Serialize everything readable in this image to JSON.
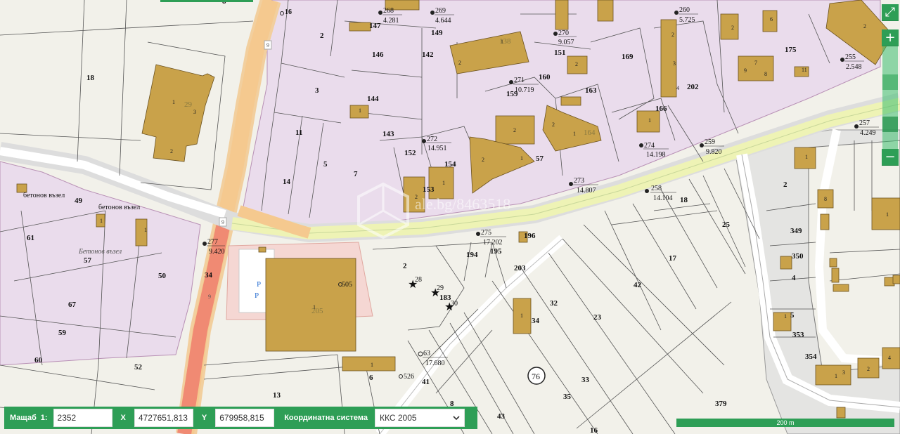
{
  "parcels": [
    {
      "num": "8"
    },
    {
      "num": "16"
    },
    {
      "num": "18"
    },
    {
      "num": "29"
    },
    {
      "num": "2"
    },
    {
      "num": "3"
    },
    {
      "num": "11"
    },
    {
      "num": "14"
    },
    {
      "num": "5"
    },
    {
      "num": "7"
    },
    {
      "num": "147"
    },
    {
      "num": "149"
    },
    {
      "num": "146"
    },
    {
      "num": "142"
    },
    {
      "num": "138"
    },
    {
      "num": "151"
    },
    {
      "num": "169"
    },
    {
      "num": "175"
    },
    {
      "num": "144"
    },
    {
      "num": "143"
    },
    {
      "num": "152"
    },
    {
      "num": "153"
    },
    {
      "num": "154"
    },
    {
      "num": "160"
    },
    {
      "num": "163"
    },
    {
      "num": "159"
    },
    {
      "num": "166"
    },
    {
      "num": "202"
    },
    {
      "num": "57"
    },
    {
      "num": "164"
    },
    {
      "num": "49"
    },
    {
      "num": "61"
    },
    {
      "num": "57"
    },
    {
      "num": "50"
    },
    {
      "num": "34"
    },
    {
      "num": "67"
    },
    {
      "num": "59"
    },
    {
      "num": "60"
    },
    {
      "num": "52"
    },
    {
      "num": "13"
    },
    {
      "num": "2"
    },
    {
      "num": "205"
    },
    {
      "num": "194"
    },
    {
      "num": "195"
    },
    {
      "num": "196"
    },
    {
      "num": "203"
    },
    {
      "num": "183"
    },
    {
      "num": "6"
    },
    {
      "num": "41"
    },
    {
      "num": "8"
    },
    {
      "num": "43"
    },
    {
      "num": "32"
    },
    {
      "num": "34"
    },
    {
      "num": "33"
    },
    {
      "num": "35"
    },
    {
      "num": "16"
    },
    {
      "num": "23"
    },
    {
      "num": "42"
    },
    {
      "num": "17"
    },
    {
      "num": "25"
    },
    {
      "num": "18"
    },
    {
      "num": "2"
    },
    {
      "num": "349"
    },
    {
      "num": "350"
    },
    {
      "num": "4"
    },
    {
      "num": "5"
    },
    {
      "num": "353"
    },
    {
      "num": "354"
    },
    {
      "num": "379"
    }
  ],
  "geodetic_points": [
    {
      "id": "268",
      "value": "4.281"
    },
    {
      "id": "269",
      "value": "4.644"
    },
    {
      "id": "270",
      "value": "9.057"
    },
    {
      "id": "260",
      "value": "5.725"
    },
    {
      "id": "255",
      "value": "2.548"
    },
    {
      "id": "271",
      "value": "10.719"
    },
    {
      "id": "272",
      "value": "14.951"
    },
    {
      "id": "274",
      "value": "14.198"
    },
    {
      "id": "259",
      "value": "9.820"
    },
    {
      "id": "257",
      "value": "4.249"
    },
    {
      "id": "273",
      "value": "14.807"
    },
    {
      "id": "258",
      "value": "14.104"
    },
    {
      "id": "277",
      "value": "9.420"
    },
    {
      "id": "275",
      "value": "17.202"
    },
    {
      "id": "63",
      "value": "17.680"
    }
  ],
  "point_labels": [
    "16",
    "505",
    "526",
    "28",
    "29",
    "30"
  ],
  "place_labels": [
    "бетонов възел",
    "бетонов възел",
    "Бетонов възел"
  ],
  "road_numbers": [
    "9",
    "9",
    "9"
  ],
  "route_badge": "76",
  "watermark": "ale.bg/8463518",
  "zoom": {
    "in_label": "+",
    "out_label": "−",
    "fullscreen_label": "⤢"
  },
  "panel": {
    "scale_label": "Мащаб",
    "scale_prefix": "1:",
    "scale_value": "2352",
    "x_label": "X",
    "x_value": "4727651,813",
    "y_label": "Y",
    "y_value": "679958,815",
    "crs_label": "Координатна система",
    "crs_value": "ККС 2005"
  },
  "scale_bar_label": "200 m",
  "colors": {
    "panel": "#2e9e56",
    "parcel_fill": "#eadcec",
    "building": "#c9a24a",
    "road_main": "#f5c98f",
    "road_highway": "#f08a73",
    "road_yellow": "#eef3b5"
  }
}
